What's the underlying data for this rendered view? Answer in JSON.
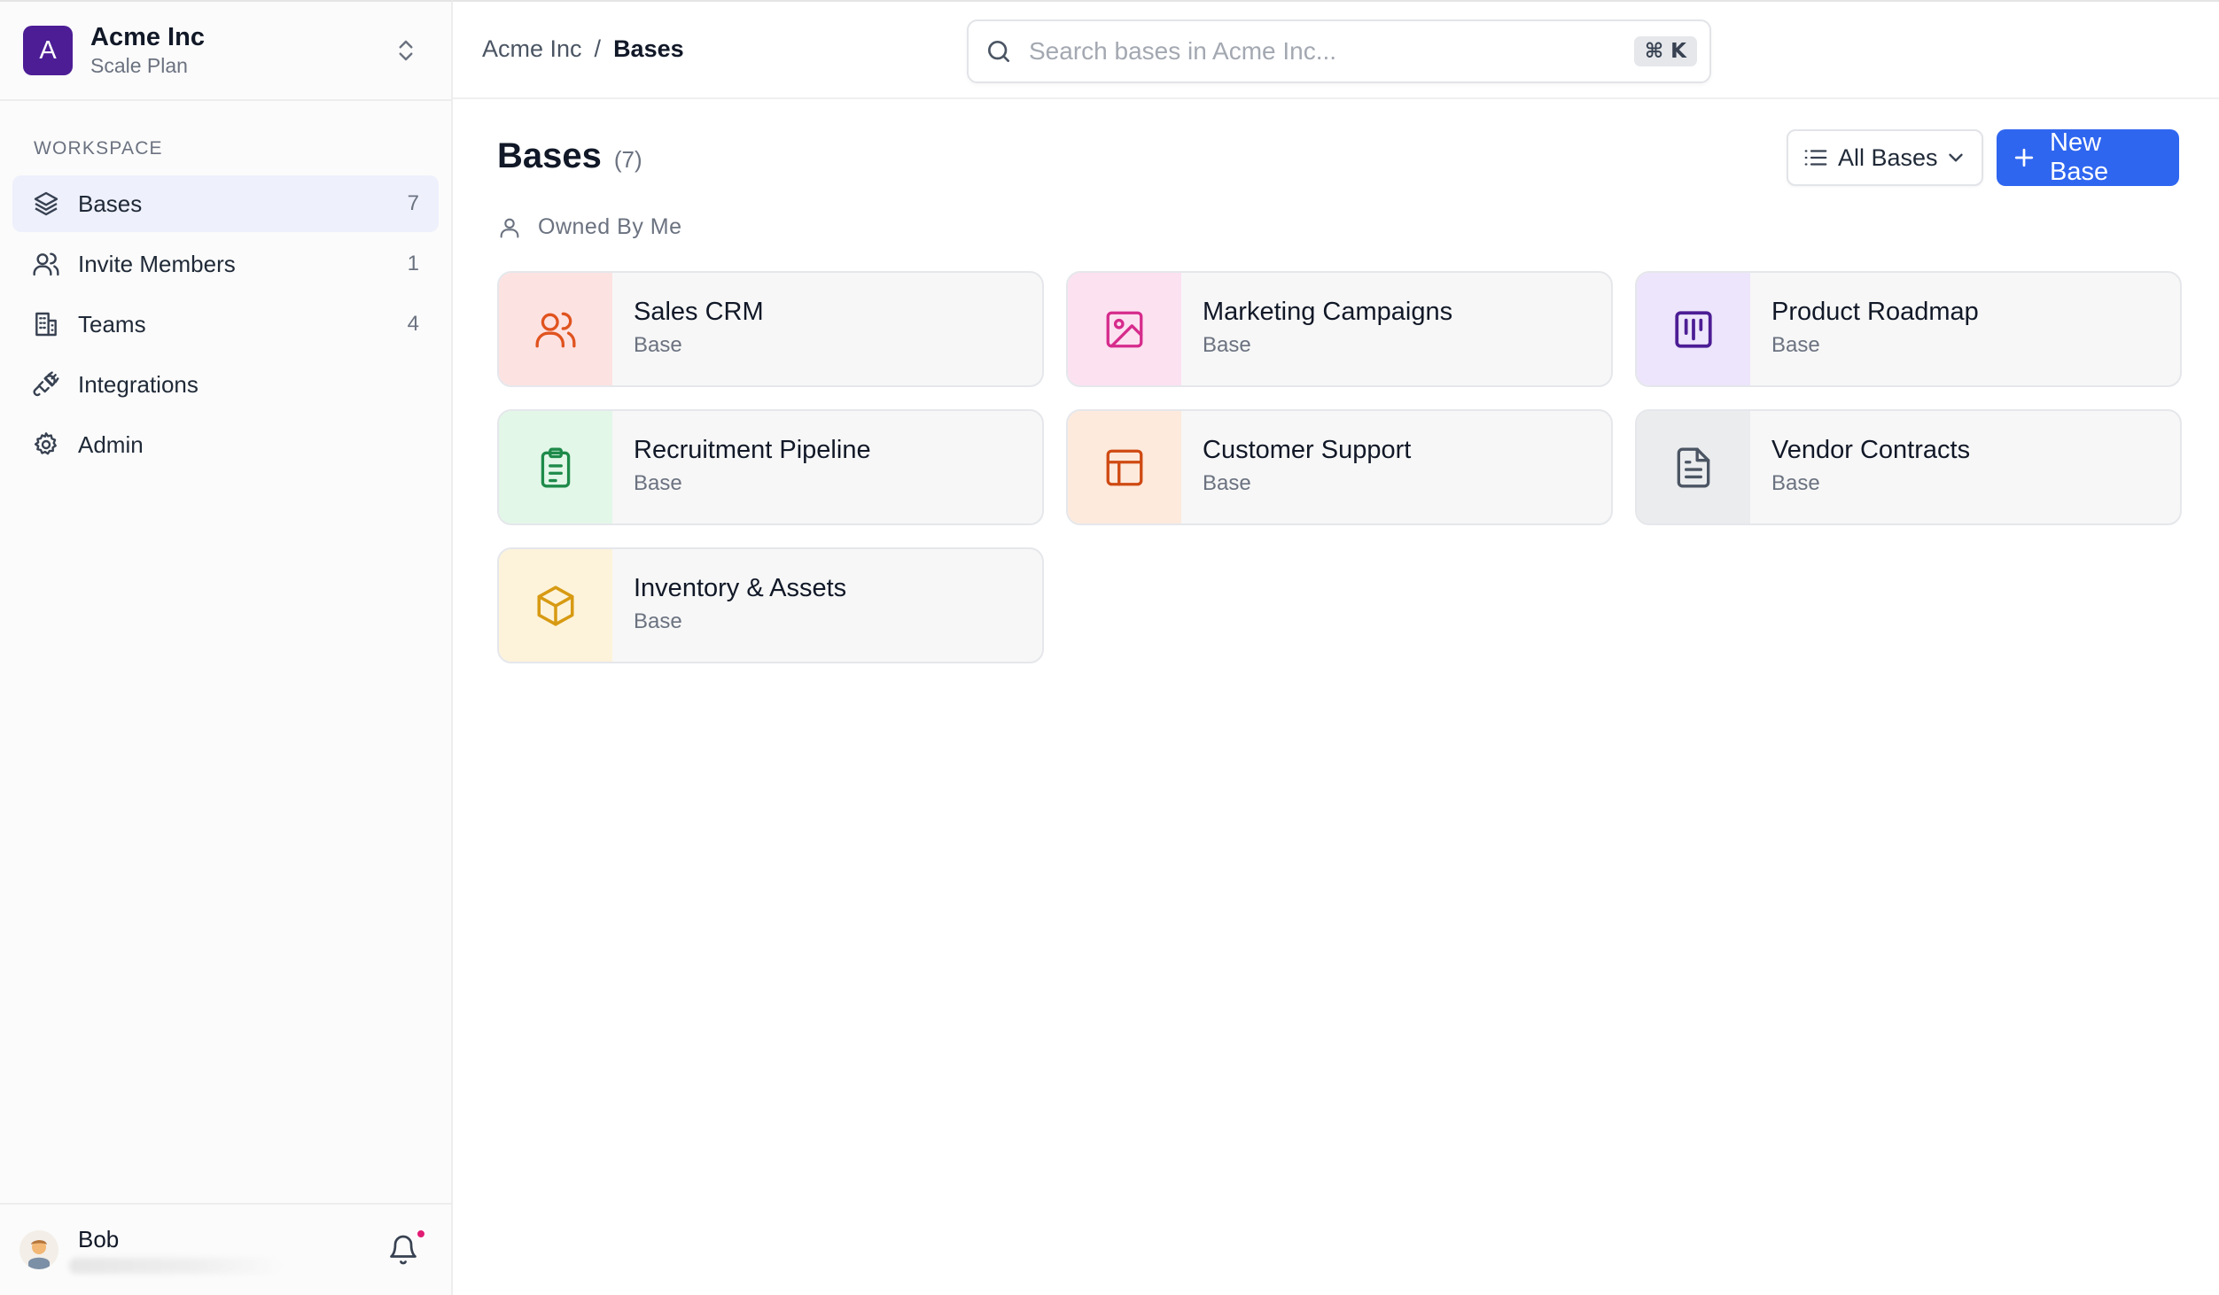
{
  "org": {
    "initial": "A",
    "name": "Acme Inc",
    "plan": "Scale Plan"
  },
  "sidebar": {
    "section_label": "WORKSPACE",
    "items": [
      {
        "label": "Bases",
        "count": "7",
        "icon": "layers-icon",
        "active": true
      },
      {
        "label": "Invite Members",
        "count": "1",
        "icon": "users-icon"
      },
      {
        "label": "Teams",
        "count": "4",
        "icon": "building-icon"
      },
      {
        "label": "Integrations",
        "count": "",
        "icon": "plug-icon"
      },
      {
        "label": "Admin",
        "count": "",
        "icon": "gear-icon"
      }
    ]
  },
  "user": {
    "name": "Bob",
    "has_notification": true
  },
  "breadcrumb": {
    "parent": "Acme Inc",
    "separator": "/",
    "current": "Bases"
  },
  "search": {
    "placeholder": "Search bases in Acme Inc...",
    "shortcut": "⌘ K"
  },
  "main": {
    "title": "Bases",
    "count": "(7)",
    "filter_label": "All Bases",
    "new_button_label": "New Base",
    "group_label": "Owned By Me"
  },
  "bases": [
    {
      "name": "Sales CRM",
      "type": "Base",
      "icon": "users-icon",
      "bg": "#fde2e2",
      "fg": "#e0531f"
    },
    {
      "name": "Marketing Campaigns",
      "type": "Base",
      "icon": "image-icon",
      "bg": "#fce1f1",
      "fg": "#d62b8c"
    },
    {
      "name": "Product Roadmap",
      "type": "Base",
      "icon": "kanban-icon",
      "bg": "#ede5fb",
      "fg": "#4c1d95"
    },
    {
      "name": "Recruitment Pipeline",
      "type": "Base",
      "icon": "clipboard-icon",
      "bg": "#e2f7e8",
      "fg": "#1e8a4a"
    },
    {
      "name": "Customer Support",
      "type": "Base",
      "icon": "layout-icon",
      "bg": "#fdeadd",
      "fg": "#cf4a12"
    },
    {
      "name": "Vendor Contracts",
      "type": "Base",
      "icon": "file-text-icon",
      "bg": "#ebecee",
      "fg": "#4b5563"
    },
    {
      "name": "Inventory & Assets",
      "type": "Base",
      "icon": "box-icon",
      "bg": "#fdf3db",
      "fg": "#d79a12"
    }
  ]
}
